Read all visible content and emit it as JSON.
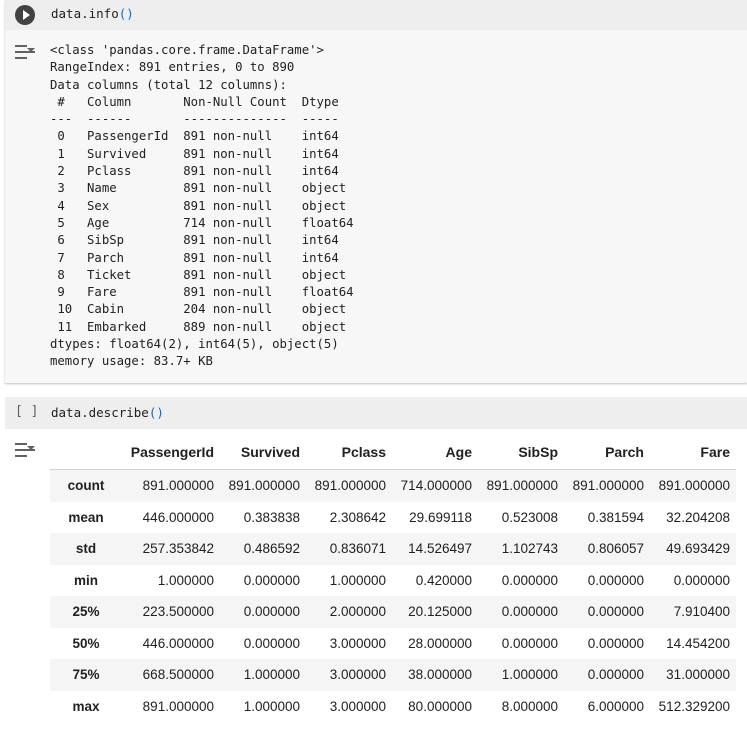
{
  "cell1": {
    "code_prefix": "data.info",
    "code_parens": "()",
    "output_lines": [
      "<class 'pandas.core.frame.DataFrame'>",
      "RangeIndex: 891 entries, 0 to 890",
      "Data columns (total 12 columns):",
      " #   Column       Non-Null Count  Dtype  ",
      "---  ------       --------------  -----  ",
      " 0   PassengerId  891 non-null    int64  ",
      " 1   Survived     891 non-null    int64  ",
      " 2   Pclass       891 non-null    int64  ",
      " 3   Name         891 non-null    object ",
      " 4   Sex          891 non-null    object ",
      " 5   Age          714 non-null    float64",
      " 6   SibSp        891 non-null    int64  ",
      " 7   Parch        891 non-null    int64  ",
      " 8   Ticket       891 non-null    object ",
      " 9   Fare         891 non-null    float64",
      " 10  Cabin        204 non-null    object ",
      " 11  Embarked     889 non-null    object ",
      "dtypes: float64(2), int64(5), object(5)",
      "memory usage: 83.7+ KB"
    ]
  },
  "cell2": {
    "bracket": "[ ]",
    "code_prefix": "data.describe",
    "code_parens": "()",
    "table": {
      "columns": [
        "",
        "PassengerId",
        "Survived",
        "Pclass",
        "Age",
        "SibSp",
        "Parch",
        "Fare"
      ],
      "rows": [
        [
          "count",
          "891.000000",
          "891.000000",
          "891.000000",
          "714.000000",
          "891.000000",
          "891.000000",
          "891.000000"
        ],
        [
          "mean",
          "446.000000",
          "0.383838",
          "2.308642",
          "29.699118",
          "0.523008",
          "0.381594",
          "32.204208"
        ],
        [
          "std",
          "257.353842",
          "0.486592",
          "0.836071",
          "14.526497",
          "1.102743",
          "0.806057",
          "49.693429"
        ],
        [
          "min",
          "1.000000",
          "0.000000",
          "1.000000",
          "0.420000",
          "0.000000",
          "0.000000",
          "0.000000"
        ],
        [
          "25%",
          "223.500000",
          "0.000000",
          "2.000000",
          "20.125000",
          "0.000000",
          "0.000000",
          "7.910400"
        ],
        [
          "50%",
          "446.000000",
          "0.000000",
          "3.000000",
          "28.000000",
          "0.000000",
          "0.000000",
          "14.454200"
        ],
        [
          "75%",
          "668.500000",
          "1.000000",
          "3.000000",
          "38.000000",
          "1.000000",
          "0.000000",
          "31.000000"
        ],
        [
          "max",
          "891.000000",
          "1.000000",
          "3.000000",
          "80.000000",
          "8.000000",
          "6.000000",
          "512.329200"
        ]
      ]
    }
  },
  "icons": {
    "run": "play-circle-icon",
    "output": "output-toggle-icon"
  }
}
